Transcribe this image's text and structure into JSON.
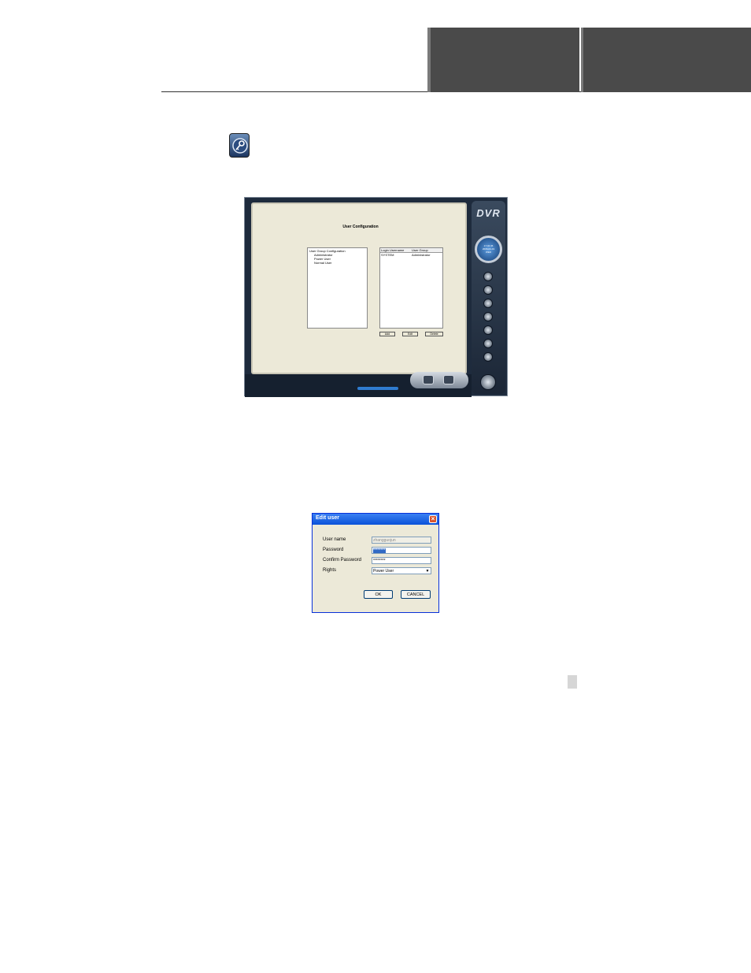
{
  "dvr_window": {
    "title": "User Configuration",
    "tree": [
      "User Group Configuration",
      "Administrator",
      "Power User",
      "Normal User"
    ],
    "list_columns": [
      "Login Username",
      "User Group"
    ],
    "list_rows": [
      [
        "SYSTEM",
        "Administrator"
      ]
    ],
    "buttons": {
      "add": "Add",
      "edit": "Edit",
      "delete": "Delete"
    },
    "logo": "DVR",
    "clock_time": "17:32:45",
    "clock_date": "2006-04-19",
    "clock_day": "WED"
  },
  "edit_user_dialog": {
    "title": "Edit user",
    "close_glyph": "×",
    "labels": {
      "user_name": "User name",
      "password": "Password",
      "confirm_password": "Confirm Password",
      "rights": "Rights"
    },
    "values": {
      "user_name": "zhangguojun",
      "password": "********",
      "confirm_password": "********",
      "rights": "Power User"
    },
    "ok_label": "OK",
    "cancel_label": "CANCEL"
  },
  "icons": {
    "header_icon": "key-icon",
    "dropdown": "chevron-down-icon"
  },
  "colors": {
    "header_box": "#4a4a4a",
    "dialog_titlebar": "#0a52d8",
    "dvr_frame": "#1e2b3d"
  }
}
